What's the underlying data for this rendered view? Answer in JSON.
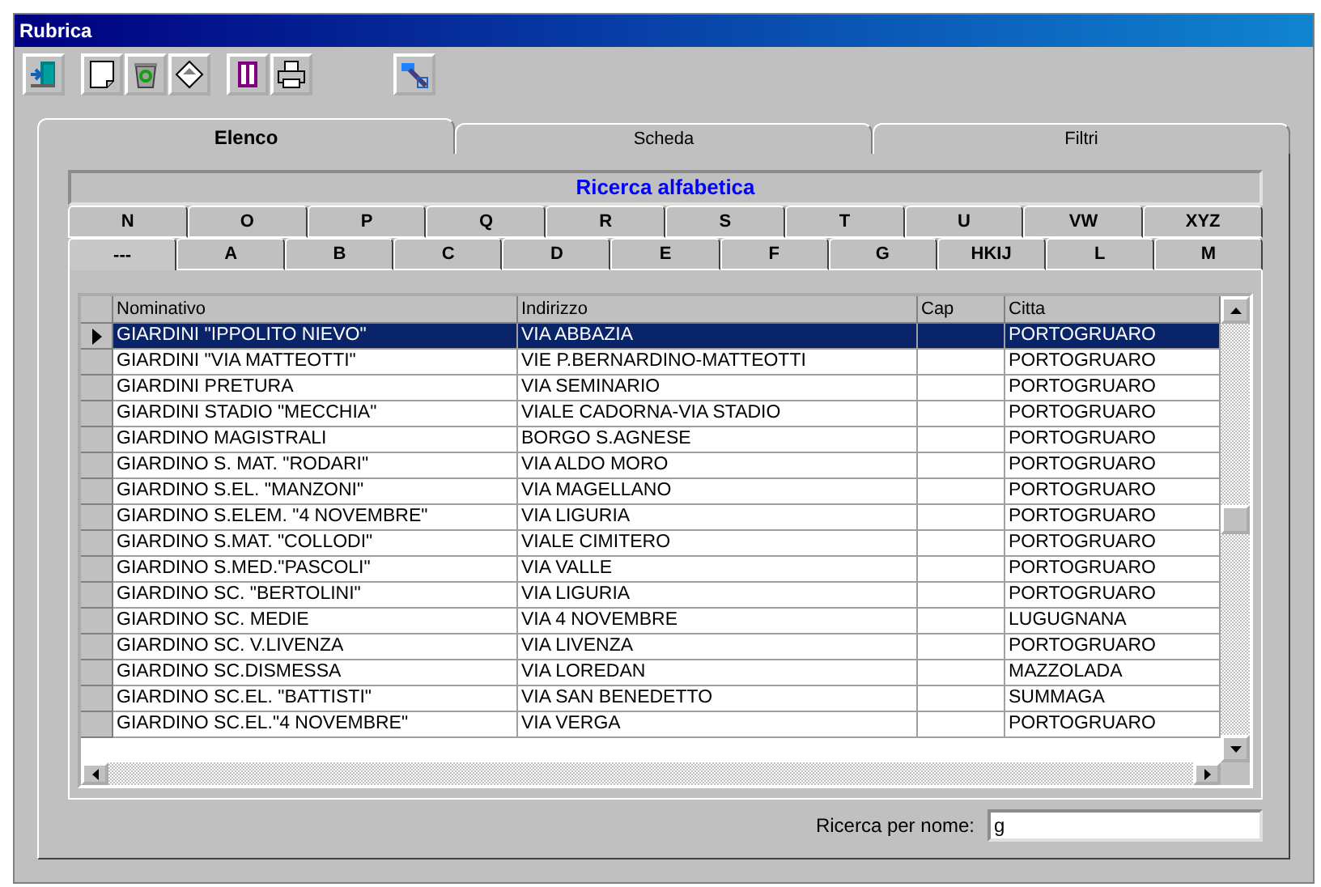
{
  "window": {
    "title": "Rubrica"
  },
  "tabs": [
    {
      "label": "Elenco",
      "selected": true
    },
    {
      "label": "Scheda",
      "selected": false
    },
    {
      "label": "Filtri",
      "selected": false
    }
  ],
  "alpha_search": {
    "title": "Ricerca alfabetica",
    "rows": [
      {
        "tabs": [
          {
            "label": "N",
            "selected": false
          },
          {
            "label": "O",
            "selected": false
          },
          {
            "label": "P",
            "selected": false
          },
          {
            "label": "Q",
            "selected": false
          },
          {
            "label": "R",
            "selected": false
          },
          {
            "label": "S",
            "selected": false
          },
          {
            "label": "T",
            "selected": false
          },
          {
            "label": "U",
            "selected": false
          },
          {
            "label": "VW",
            "selected": false
          },
          {
            "label": "XYZ",
            "selected": false
          }
        ]
      },
      {
        "tabs": [
          {
            "label": "---",
            "selected": true
          },
          {
            "label": "A",
            "selected": false
          },
          {
            "label": "B",
            "selected": false
          },
          {
            "label": "C",
            "selected": false
          },
          {
            "label": "D",
            "selected": false
          },
          {
            "label": "E",
            "selected": false
          },
          {
            "label": "F",
            "selected": false
          },
          {
            "label": "G",
            "selected": false
          },
          {
            "label": "HKIJ",
            "selected": false
          },
          {
            "label": "L",
            "selected": false
          },
          {
            "label": "M",
            "selected": false
          }
        ]
      }
    ]
  },
  "table": {
    "columns": [
      "Nominativo",
      "Indirizzo",
      "Cap",
      "Citta"
    ],
    "rows": [
      {
        "nominativo": "GIARDINI \"IPPOLITO NIEVO\"",
        "indirizzo": "VIA ABBAZIA",
        "citta": "PORTOGRUARO",
        "selected": true
      },
      {
        "nominativo": "GIARDINI \"VIA MATTEOTTI\"",
        "indirizzo": "VIE P.BERNARDINO-MATTEOTTI",
        "citta": "PORTOGRUARO",
        "selected": false
      },
      {
        "nominativo": "GIARDINI PRETURA",
        "indirizzo": "VIA SEMINARIO",
        "citta": "PORTOGRUARO",
        "selected": false
      },
      {
        "nominativo": "GIARDINI STADIO \"MECCHIA\"",
        "indirizzo": "VIALE CADORNA-VIA STADIO",
        "citta": "PORTOGRUARO",
        "selected": false
      },
      {
        "nominativo": "GIARDINO MAGISTRALI",
        "indirizzo": "BORGO S.AGNESE",
        "citta": "PORTOGRUARO",
        "selected": false
      },
      {
        "nominativo": "GIARDINO S. MAT. \"RODARI\"",
        "indirizzo": "VIA ALDO MORO",
        "citta": "PORTOGRUARO",
        "selected": false
      },
      {
        "nominativo": "GIARDINO S.EL. \"MANZONI\"",
        "indirizzo": "VIA MAGELLANO",
        "citta": "PORTOGRUARO",
        "selected": false
      },
      {
        "nominativo": "GIARDINO S.ELEM. \"4 NOVEMBRE\"",
        "indirizzo": "VIA LIGURIA",
        "citta": "PORTOGRUARO",
        "selected": false
      },
      {
        "nominativo": "GIARDINO S.MAT. \"COLLODI\"",
        "indirizzo": "VIALE CIMITERO",
        "citta": "PORTOGRUARO",
        "selected": false
      },
      {
        "nominativo": "GIARDINO S.MED.\"PASCOLI\"",
        "indirizzo": "VIA VALLE",
        "citta": "PORTOGRUARO",
        "selected": false
      },
      {
        "nominativo": "GIARDINO SC. \"BERTOLINI\"",
        "indirizzo": "VIA LIGURIA",
        "citta": "PORTOGRUARO",
        "selected": false
      },
      {
        "nominativo": "GIARDINO SC. MEDIE",
        "indirizzo": "VIA 4 NOVEMBRE",
        "citta": "LUGUGNANA",
        "selected": false
      },
      {
        "nominativo": "GIARDINO SC. V.LIVENZA",
        "indirizzo": "VIA LIVENZA",
        "citta": "PORTOGRUARO",
        "selected": false
      },
      {
        "nominativo": "GIARDINO SC.DISMESSA",
        "indirizzo": "VIA LOREDAN",
        "citta": "MAZZOLADA",
        "selected": false
      },
      {
        "nominativo": "GIARDINO SC.EL. \"BATTISTI\"",
        "indirizzo": "VIA SAN BENEDETTO",
        "citta": "SUMMAGA",
        "selected": false
      },
      {
        "nominativo": "GIARDINO SC.EL.\"4 NOVEMBRE\"",
        "indirizzo": "VIA VERGA",
        "citta": "PORTOGRUARO",
        "selected": false
      }
    ]
  },
  "search": {
    "label": "Ricerca per nome:",
    "value": "g"
  }
}
